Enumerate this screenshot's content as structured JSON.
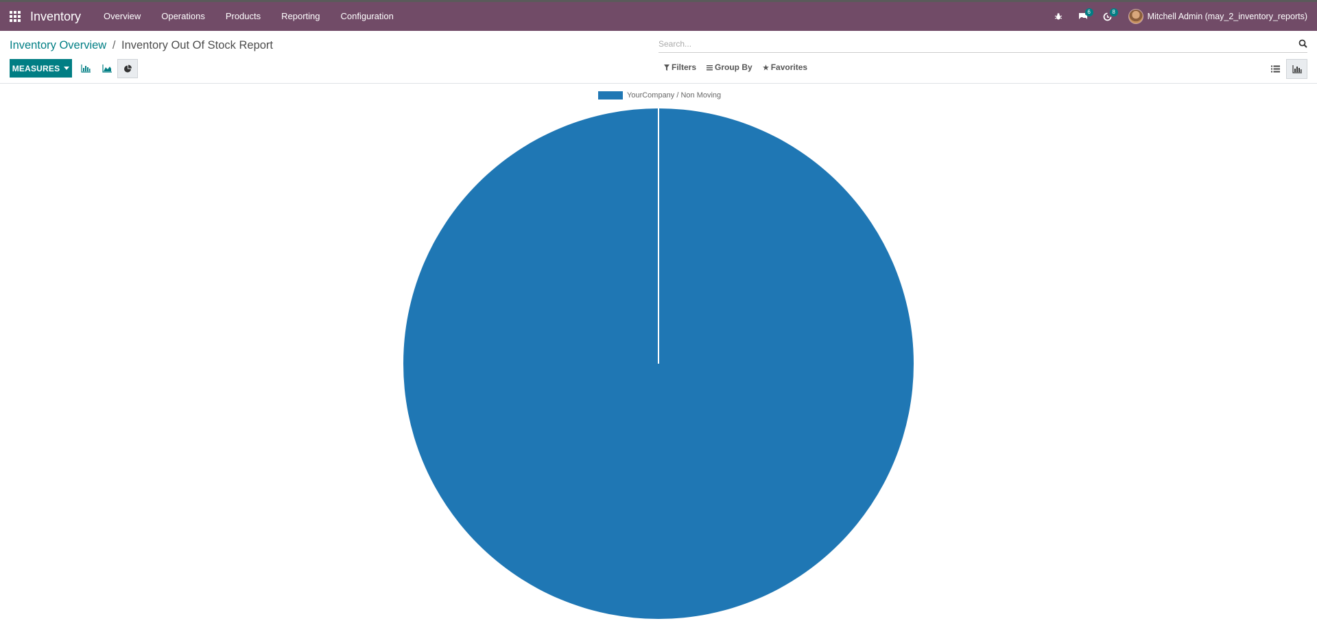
{
  "app": {
    "title": "Inventory"
  },
  "menu": [
    {
      "label": "Overview"
    },
    {
      "label": "Operations"
    },
    {
      "label": "Products"
    },
    {
      "label": "Reporting"
    },
    {
      "label": "Configuration"
    }
  ],
  "systray": {
    "messages_count": "6",
    "activities_count": "8",
    "user_name": "Mitchell Admin (may_2_inventory_reports)"
  },
  "breadcrumb": {
    "parent": "Inventory Overview",
    "separator": "/",
    "current": "Inventory Out Of Stock Report"
  },
  "toolbar": {
    "measures_label": "MEASURES",
    "active_chart": "pie"
  },
  "search": {
    "placeholder": "Search...",
    "value": ""
  },
  "filters": {
    "filters_label": "Filters",
    "groupby_label": "Group By",
    "favorites_label": "Favorites"
  },
  "views": {
    "active": "graph"
  },
  "colors": {
    "navbar": "#714B67",
    "primary": "#017e84",
    "series": "#1f77b4"
  },
  "chart_data": {
    "type": "pie",
    "title": "",
    "categories": [
      "YourCompany / Non Moving"
    ],
    "values": [
      1
    ],
    "legend": [
      "YourCompany / Non Moving"
    ],
    "legend_position": "top"
  }
}
